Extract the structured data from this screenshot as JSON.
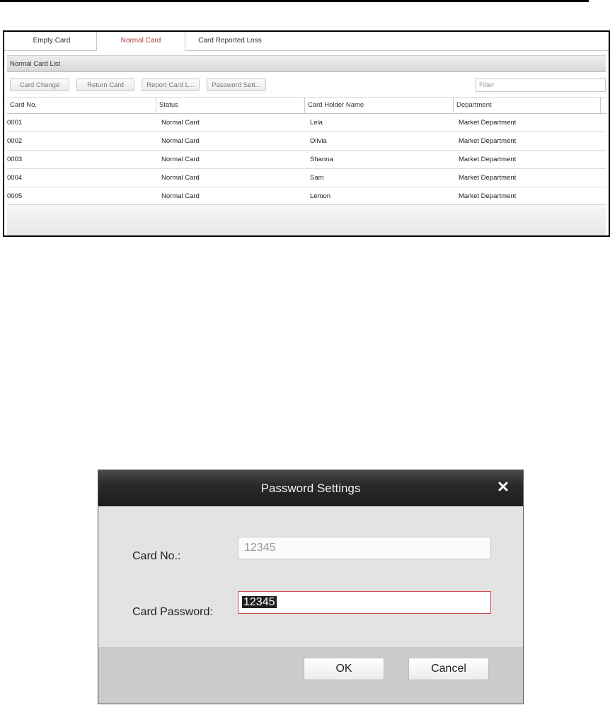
{
  "tabs": [
    {
      "label": "Empty Card"
    },
    {
      "label": "Normal Card",
      "active": true
    },
    {
      "label": "Card Reported Loss"
    }
  ],
  "list": {
    "title": "Normal Card List",
    "toolbar": {
      "card_change": "Card Change",
      "return_card": "Return Card",
      "report_card_loss": "Report Card L...",
      "password_settings": "Password Sett...",
      "filter_placeholder": "Filter"
    },
    "columns": [
      "Card No.",
      "Status",
      "Card Holder Name",
      "Department"
    ],
    "rows": [
      [
        "0001",
        "Normal Card",
        "Lela",
        "Market Department"
      ],
      [
        "0002",
        "Normal Card",
        "Olivia",
        "Market Department"
      ],
      [
        "0003",
        "Normal Card",
        "Shanna",
        "Market Department"
      ],
      [
        "0004",
        "Normal Card",
        "Sam",
        "Market Department"
      ],
      [
        "0005",
        "Normal Card",
        "Lemon",
        "Market Department"
      ]
    ]
  },
  "dialog": {
    "title": "Password Settings",
    "card_no_label": "Card No.:",
    "card_no_value": "12345",
    "card_password_label": "Card Password:",
    "card_password_value": "12345",
    "ok": "OK",
    "cancel": "Cancel"
  },
  "colors": {
    "active_tab": "#b43c3c",
    "password_border": "#d14b4b",
    "title_bar": "#1c1c1c"
  }
}
